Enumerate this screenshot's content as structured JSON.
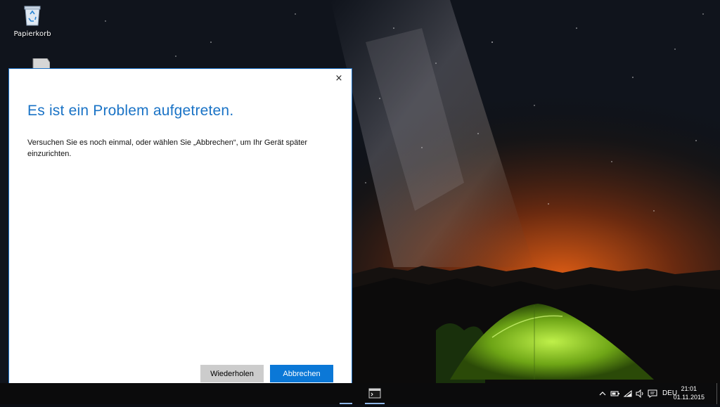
{
  "desktop": {
    "icons": [
      {
        "label": "Papierkorb",
        "icon": "recycle-bin-icon"
      }
    ]
  },
  "dialog": {
    "title": "Es ist ein Problem aufgetreten.",
    "message": "Versuchen Sie es noch einmal, oder wählen Sie „Abbrechen“, um Ihr Gerät später einzurichten.",
    "close_label": "×",
    "retry_label": "Wiederholen",
    "cancel_label": "Abbrechen",
    "accent": "#0b78d7",
    "title_color": "#1a73c6"
  },
  "taskbar": {
    "language": "DEU",
    "time": "21:01",
    "date": "01.11.2015",
    "tray_icons": [
      "chevron-up-icon",
      "battery-icon",
      "wifi-icon",
      "speaker-icon",
      "action-center-icon"
    ],
    "apps": [
      "command-prompt-icon"
    ]
  }
}
